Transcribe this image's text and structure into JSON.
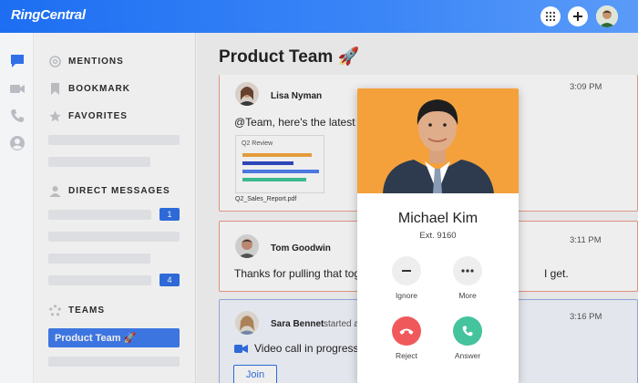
{
  "app": {
    "logo_text": "RingCentral",
    "brand_color": "#1d6ef2"
  },
  "topbar": {
    "icons": [
      "dialpad-icon",
      "plus-icon",
      "user-avatar"
    ]
  },
  "rail": {
    "icons": [
      "messages-icon",
      "video-icon",
      "phone-icon",
      "contacts-icon"
    ]
  },
  "sidebar": {
    "mentions": "MENTIONS",
    "bookmark": "BOOKMARK",
    "favorites": "FAVORITES",
    "direct_messages": "DIRECT MESSAGES",
    "dm_counts": [
      "1",
      "4"
    ],
    "teams": "TEAMS",
    "active_team": "Product Team 🚀"
  },
  "main": {
    "channel_title": "Product Team 🚀",
    "messages": [
      {
        "author": "Lisa Nyman",
        "time": "3:09 PM",
        "body": "@Team, here's the latest o",
        "file": {
          "title": "Q2 Review",
          "name": "Q2_Sales_Report.pdf"
        }
      },
      {
        "author": "Tom Goodwin",
        "time": "3:11 PM",
        "body": "Thanks for pulling that tog",
        "body_tail": "I get."
      },
      {
        "author": "Sara Bennet",
        "author_action": "started a",
        "time": "3:16 PM",
        "body": "Video call in progress",
        "join_label": "Join"
      }
    ]
  },
  "call": {
    "caller_name": "Michael Kim",
    "extension": "Ext. 9160",
    "actions": [
      {
        "label": "Ignore",
        "icon": "minus-icon"
      },
      {
        "label": "More",
        "icon": "more-icon"
      },
      {
        "label": "Reject",
        "icon": "hangup-icon"
      },
      {
        "label": "Answer",
        "icon": "phone-answer-icon"
      }
    ],
    "photo_bg": "#f4a13c",
    "reject_color": "#f0595b",
    "answer_color": "#45c39c"
  }
}
